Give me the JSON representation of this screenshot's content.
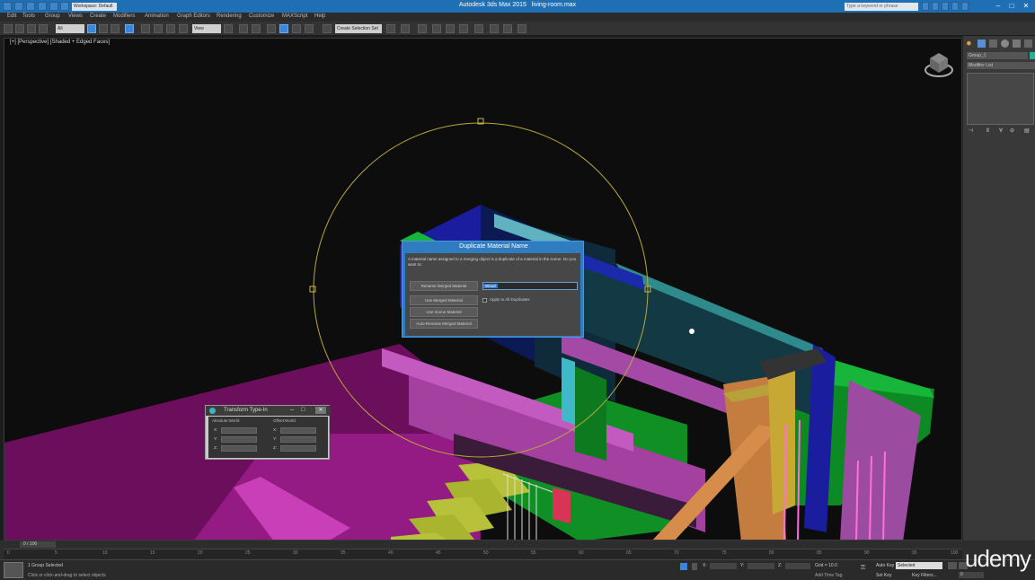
{
  "window": {
    "title": "Autodesk 3ds Max 2015",
    "filename": "living-room.max",
    "workspace": "Workspace: Default",
    "search_placeholder": "Type a keyword or phrase"
  },
  "menu": [
    "Edit",
    "Tools",
    "Group",
    "Views",
    "Create",
    "Modifiers",
    "Animation",
    "Graph Editors",
    "Rendering",
    "Customize",
    "MAXScript",
    "Help"
  ],
  "toolbar": {
    "selection_filter": "All",
    "view_ref": "View",
    "named_selection": "Create Selection Set"
  },
  "viewport": {
    "label": "[+] [Perspective] [Shaded + Edged Faces]"
  },
  "dialog": {
    "title": "Duplicate Material Name",
    "message": "A material name assigned to a merging object is a duplicate of a material in the scene. Do you want to:",
    "rename_button": "Rename Merged Material",
    "rename_value": "Wood",
    "use_merged_button": "Use Merged Material",
    "use_scene_button": "Use Scene Material",
    "auto_rename_button": "Auto-Rename Merged Material",
    "apply_all_label": "Apply to All Duplicates"
  },
  "transform": {
    "title": "Transform Type-In",
    "absolute_label": "Absolute:World",
    "offset_label": "Offset:World",
    "axes": [
      "X:",
      "Y:",
      "Z:"
    ]
  },
  "command_panel": {
    "object_name": "Group_1",
    "modifier_list": "Modifier List"
  },
  "timeline": {
    "frame_indicator": "0 / 100",
    "ticks": [
      "0",
      "5",
      "10",
      "15",
      "20",
      "25",
      "30",
      "35",
      "40",
      "45",
      "50",
      "55",
      "60",
      "65",
      "70",
      "75",
      "80",
      "85",
      "90",
      "95",
      "100"
    ]
  },
  "status": {
    "selection": "1 Group Selected",
    "prompt": "Click or click-and-drag to select objects",
    "grid": "Grid = 10.0",
    "add_time_tag": "Add Time Tag",
    "auto_key": "Auto Key",
    "auto_key_value": "Selected",
    "set_key": "Set Key",
    "key_filters": "Key Filters...",
    "frame": "0"
  },
  "watermark": "udemy"
}
